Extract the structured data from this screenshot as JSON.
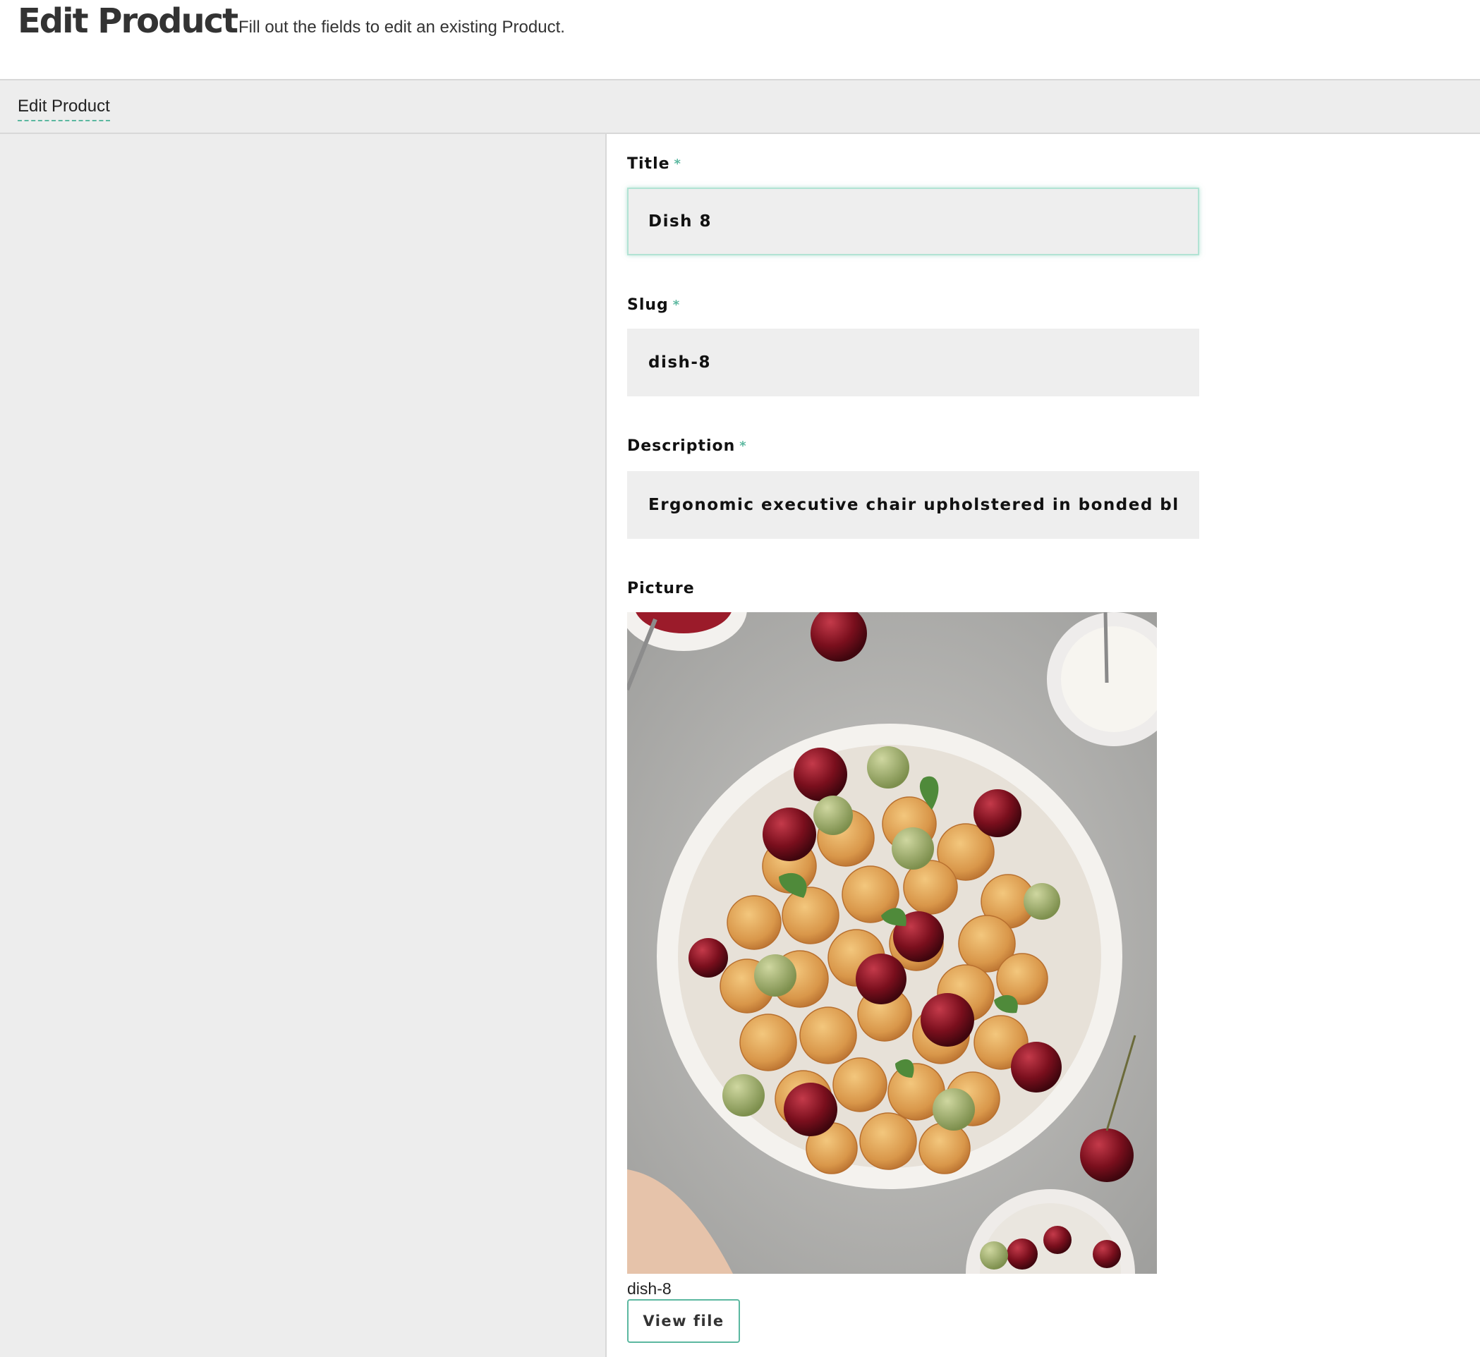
{
  "header": {
    "title": "Edit Product",
    "subtitle": "Fill out the fields to edit an existing Product."
  },
  "tabs": [
    {
      "label": "Edit Product",
      "active": true
    }
  ],
  "form": {
    "required_marker": "*",
    "title": {
      "label": "Title",
      "value": "Dish 8",
      "focused": true
    },
    "slug": {
      "label": "Slug",
      "value": "dish-8"
    },
    "description": {
      "label": "Description",
      "value": "Ergonomic executive chair upholstered in bonded black leathe"
    },
    "picture": {
      "label": "Picture",
      "image_alt": "mini pancakes with cherries in a white bowl",
      "file_name": "dish-8",
      "view_button_label": "View file"
    }
  },
  "colors": {
    "accent": "#5cb8a0",
    "sidebar_bg": "#ededed",
    "input_bg": "#eeeeee"
  }
}
